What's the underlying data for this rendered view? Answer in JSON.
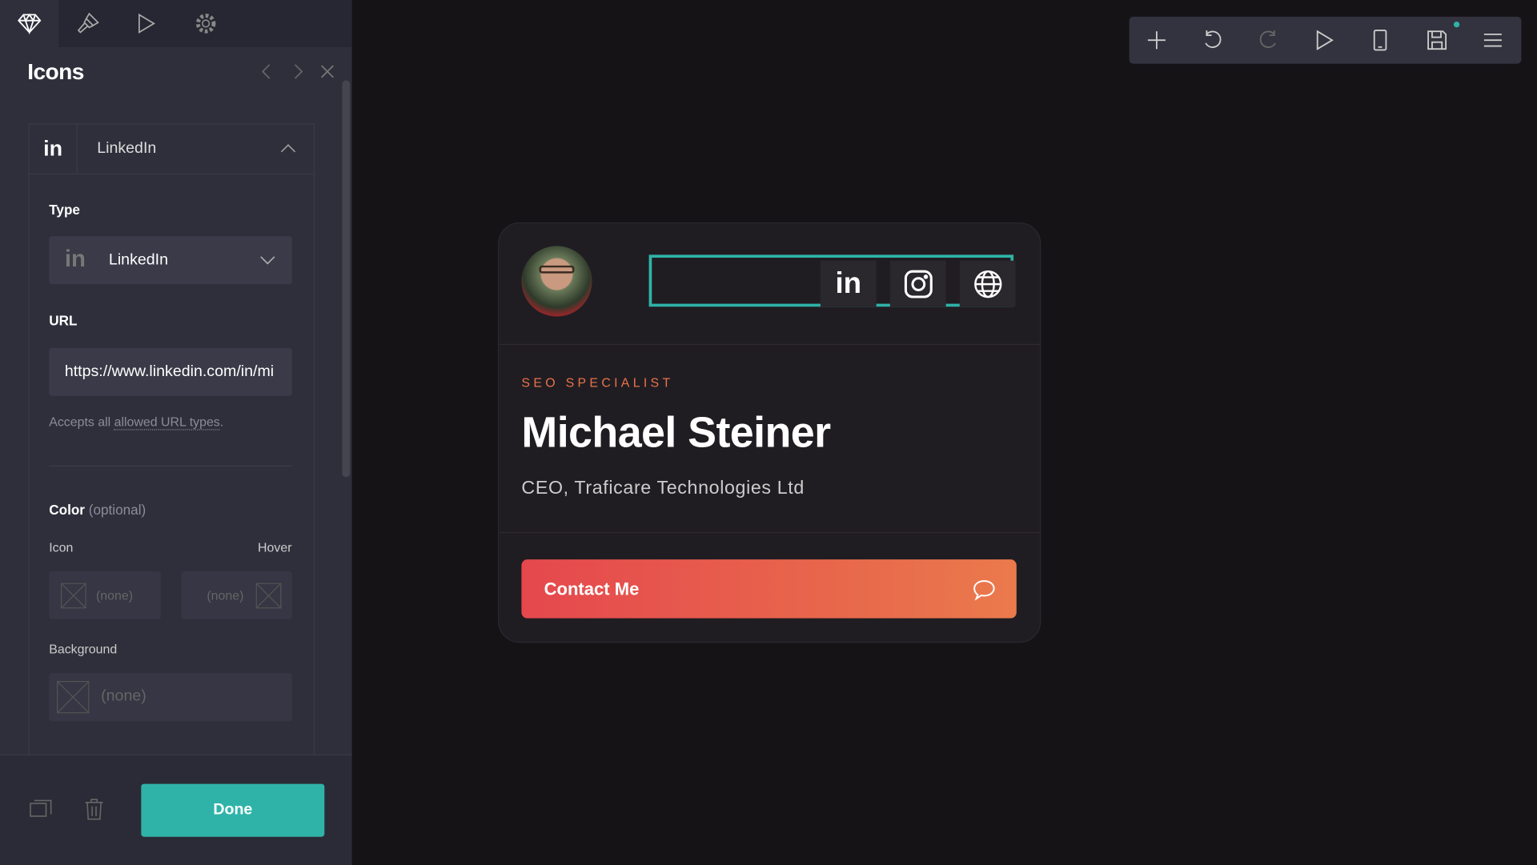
{
  "panel": {
    "tabs": [
      {
        "icon": "diamond-icon"
      },
      {
        "icon": "paintbrush-icon"
      },
      {
        "icon": "play-icon"
      },
      {
        "icon": "gear-icon"
      }
    ],
    "title": "Icons",
    "item": {
      "icon_text": "in",
      "label": "LinkedIn"
    },
    "type_label": "Type",
    "type_value": "LinkedIn",
    "url_label": "URL",
    "url_value": "https://www.linkedin.com/in/mi",
    "hint_prefix": "Accepts all ",
    "hint_link": "allowed URL types",
    "hint_suffix": ".",
    "color_label": "Color",
    "color_optional": "(optional)",
    "icon_label": "Icon",
    "hover_label": "Hover",
    "icon_color": "(none)",
    "hover_color": "(none)",
    "background_label": "Background",
    "background_color": "(none)",
    "done_label": "Done"
  },
  "card": {
    "role": "SEO SPECIALIST",
    "name": "Michael Steiner",
    "subtitle": "CEO, Traficare Technologies Ltd",
    "contact_label": "Contact Me",
    "social": [
      "linkedin-icon",
      "instagram-icon",
      "globe-icon"
    ]
  },
  "colors": {
    "accent": "#2fb3a8",
    "role": "#e8734a",
    "button_start": "#e5474d",
    "button_end": "#ea7a4c"
  }
}
